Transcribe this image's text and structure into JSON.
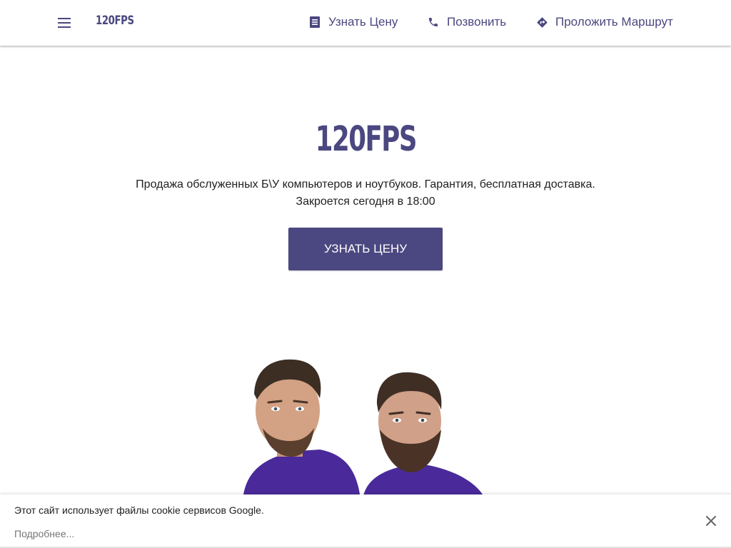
{
  "header": {
    "menu_icon": "hamburger-menu-icon",
    "brand": "120FPS",
    "actions": [
      {
        "label": "Узнать Цену",
        "icon": "document-icon"
      },
      {
        "label": "Позвонить",
        "icon": "phone-icon"
      },
      {
        "label": "Проложить Маршрут",
        "icon": "directions-icon"
      }
    ]
  },
  "hero": {
    "title": "120FPS",
    "description": "Продажа обслуженных Б\\У компьютеров и ноутбуков. Гарантия, бесплатная доставка.",
    "hours": "Закроется сегодня в 18:00",
    "cta_label": "УЗНАТЬ ЦЕНУ"
  },
  "cookie_banner": {
    "text": "Этот сайт использует файлы cookie сервисов Google.",
    "more_link": "Подробнее...",
    "close_icon": "close-icon"
  },
  "colors": {
    "brand": "#4b4780",
    "text": "#212121",
    "muted": "#757575",
    "shirt": "#4a2a9a"
  }
}
